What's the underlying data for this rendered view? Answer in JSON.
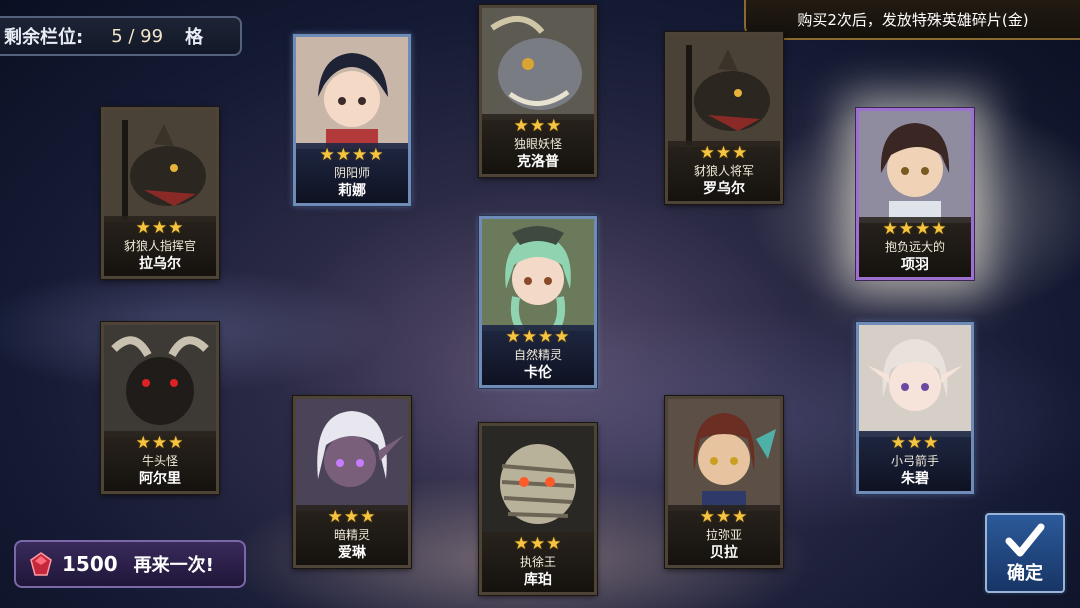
{
  "slot_counter": {
    "label": "剩余栏位:",
    "value": "5 / 99",
    "unit": "格"
  },
  "banner": {
    "text": "购买2次后，发放特殊英雄碎片(金)"
  },
  "cards": [
    {
      "id": "lina",
      "rarity": 4,
      "stars": "★★★★",
      "title": "阴阳师",
      "name": "莉娜",
      "frame": "r4",
      "portrait": "anime-girl-dark-hair"
    },
    {
      "id": "cyclops",
      "rarity": 3,
      "stars": "★★★",
      "title": "独眼妖怪",
      "name": "克洛普",
      "frame": "r3",
      "portrait": "monster-grey"
    },
    {
      "id": "gnoll-general",
      "rarity": 3,
      "stars": "★★★",
      "title": "豺狼人将军",
      "name": "罗乌尔",
      "frame": "r3",
      "portrait": "gnoll"
    },
    {
      "id": "xiangyu",
      "rarity": 4,
      "stars": "★★★★",
      "title": "抱负远大的",
      "name": "项羽",
      "frame": "purple",
      "portrait": "young-man"
    },
    {
      "id": "gnoll-commander",
      "rarity": 3,
      "stars": "★★★",
      "title": "豺狼人指挥官",
      "name": "拉乌尔",
      "frame": "r3",
      "portrait": "gnoll"
    },
    {
      "id": "karen",
      "rarity": 4,
      "stars": "★★★★",
      "title": "自然精灵",
      "name": "卡伦",
      "frame": "r4",
      "portrait": "green-hair-elf"
    },
    {
      "id": "minotaur",
      "rarity": 3,
      "stars": "★★★",
      "title": "牛头怪",
      "name": "阿尔里",
      "frame": "r3",
      "portrait": "minotaur"
    },
    {
      "id": "archer",
      "rarity": 3,
      "stars": "★★★",
      "title": "小弓箭手",
      "name": "朱碧",
      "frame": "r4",
      "portrait": "white-hair-elf"
    },
    {
      "id": "dark-elf",
      "rarity": 3,
      "stars": "★★★",
      "title": "暗精灵",
      "name": "爱琳",
      "frame": "r3",
      "portrait": "dark-elf"
    },
    {
      "id": "mummy-king",
      "rarity": 3,
      "stars": "★★★",
      "title": "执徐王",
      "name": "库珀",
      "frame": "r3",
      "portrait": "mummy"
    },
    {
      "id": "lamia",
      "rarity": 3,
      "stars": "★★★",
      "title": "拉弥亚",
      "name": "贝拉",
      "frame": "r3",
      "portrait": "lamia-girl"
    }
  ],
  "retry_button": {
    "cost": "1500",
    "label": "再来一次!",
    "gem_color": "#c4283a"
  },
  "confirm_button": {
    "label": "确定"
  },
  "colors": {
    "star": "#f5c542",
    "rare_frame": "#6f8bb8",
    "epic_frame": "#9d6fd1",
    "common_frame": "#4d4437"
  }
}
